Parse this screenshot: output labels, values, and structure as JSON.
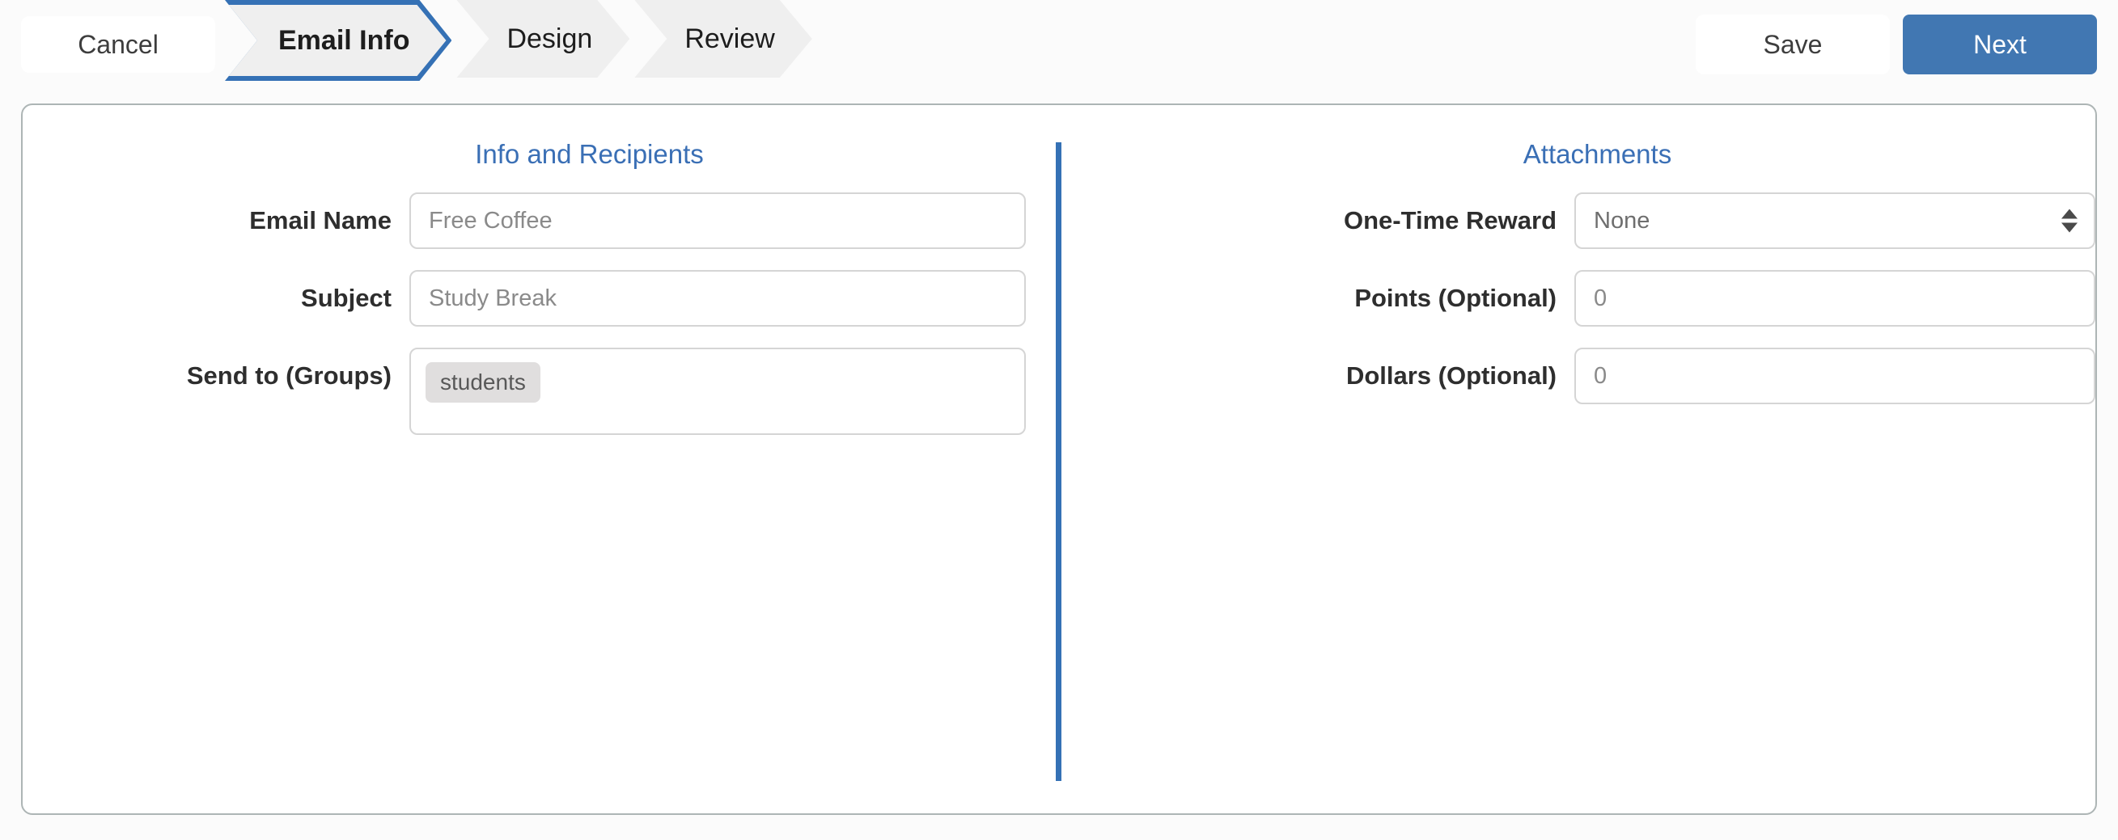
{
  "topbar": {
    "cancel_label": "Cancel",
    "save_label": "Save",
    "next_label": "Next",
    "steps": [
      {
        "label": "Email Info",
        "active": true
      },
      {
        "label": "Design",
        "active": false
      },
      {
        "label": "Review",
        "active": false
      }
    ]
  },
  "colors": {
    "accent_blue": "#3571b5",
    "button_blue": "#4177b2",
    "heading_blue": "#3a6fb5",
    "chip_gray": "#e0dede",
    "card_border": "#adb5b5",
    "page_bg": "#fbfbfb"
  },
  "left_panel": {
    "title": "Info and Recipients",
    "fields": {
      "email_name": {
        "label": "Email Name",
        "value": "Free Coffee",
        "placeholder": "Free Coffee"
      },
      "subject": {
        "label": "Subject",
        "value": "Study Break",
        "placeholder": "Study Break"
      },
      "send_to_groups": {
        "label": "Send to (Groups)",
        "chips": [
          "students"
        ]
      }
    }
  },
  "right_panel": {
    "title": "Attachments",
    "fields": {
      "one_time_reward": {
        "label": "One-Time Reward",
        "selected": "None",
        "options": [
          "None"
        ]
      },
      "points": {
        "label": "Points (Optional)",
        "value": "0",
        "placeholder": "0"
      },
      "dollars": {
        "label": "Dollars (Optional)",
        "value": "0",
        "placeholder": "0"
      }
    }
  },
  "icons": {
    "select_spinner": "spinner-up-down-icon"
  }
}
